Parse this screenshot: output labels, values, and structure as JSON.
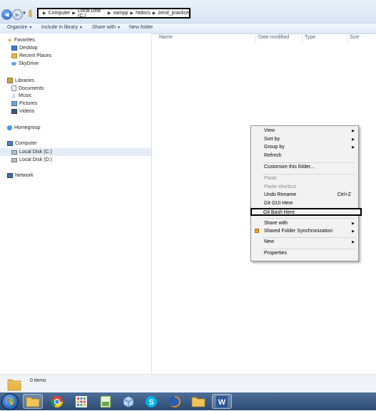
{
  "address": {
    "breadcrumbs": [
      "Computer",
      "Local Disk (C:)",
      "xampp",
      "htdocs",
      "zend_practice"
    ]
  },
  "toolbar": {
    "organize": "Organize",
    "include_in_library": "Include in library",
    "share_with": "Share with",
    "new_folder": "New folder"
  },
  "nav": {
    "favorites": "Favorites",
    "desktop": "Desktop",
    "recent_places": "Recent Places",
    "skydrive": "SkyDrive",
    "libraries": "Libraries",
    "documents": "Documents",
    "music": "Music",
    "pictures": "Pictures",
    "videos": "Videos",
    "homegroup": "Homegroup",
    "computer": "Computer",
    "local_disk_c": "Local Disk (C:)",
    "local_disk_d": "Local Disk (D:)",
    "network": "Network"
  },
  "columns": {
    "name": "Name",
    "date_modified": "Date modified",
    "type": "Type",
    "size": "Size"
  },
  "context_menu": {
    "view": "View",
    "sort_by": "Sort by",
    "group_by": "Group by",
    "refresh": "Refresh",
    "customize": "Customize this folder...",
    "paste": "Paste",
    "paste_shortcut": "Paste shortcut",
    "undo_rename": "Undo Rename",
    "undo_shortcut": "Ctrl+Z",
    "git_gui": "Git GUI Here",
    "git_bash": "Git Bash Here",
    "share_with": "Share with",
    "shared_folder_sync": "Shared Folder Synchronization",
    "new": "New",
    "properties": "Properties"
  },
  "status": {
    "item_count": "0 items"
  },
  "taskbar": {
    "icons": [
      "explorer-icon",
      "chrome-icon",
      "apps-grid-icon",
      "notepad-icon",
      "virtualbox-icon",
      "skype-icon",
      "firefox-icon",
      "folder-icon",
      "word-icon"
    ]
  }
}
